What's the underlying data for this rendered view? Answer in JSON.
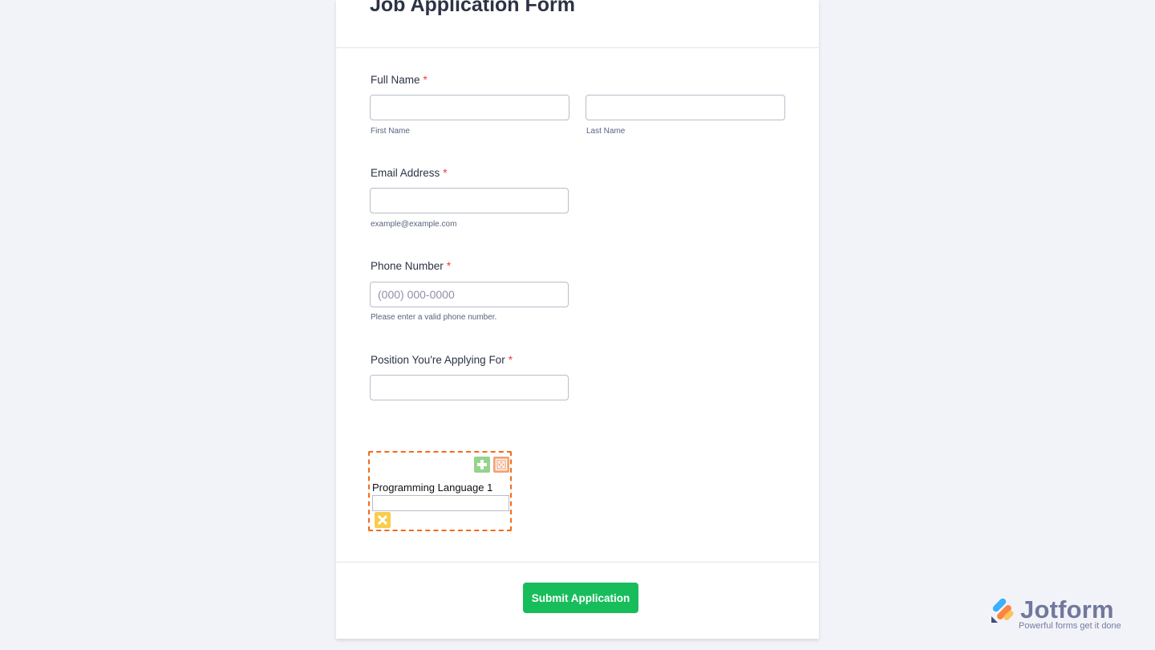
{
  "form": {
    "title": "Job Application Form",
    "required_mark": "*",
    "full_name": {
      "label": "Full Name",
      "first_sublabel": "First Name",
      "last_sublabel": "Last Name",
      "first_value": "",
      "last_value": ""
    },
    "email": {
      "label": "Email Address",
      "sublabel": "example@example.com",
      "value": ""
    },
    "phone": {
      "label": "Phone Number",
      "placeholder": "(000) 000-0000",
      "sublabel": "Please enter a valid phone number.",
      "value": ""
    },
    "position": {
      "label": "Position You're Applying For",
      "value": ""
    },
    "widget": {
      "item_label": "Programming Language 1",
      "value": "",
      "add_icon": "plus-icon",
      "delete_icon": "delete-row-icon",
      "clear_icon": "x-icon"
    },
    "submit_label": "Submit Application"
  },
  "branding": {
    "name": "Jotform",
    "tagline": "Powerful forms get it done"
  },
  "colors": {
    "background": "#f2f3f9",
    "submit": "#18bd5b",
    "required": "#f23a3c",
    "widget_border": "#f26b1d"
  }
}
